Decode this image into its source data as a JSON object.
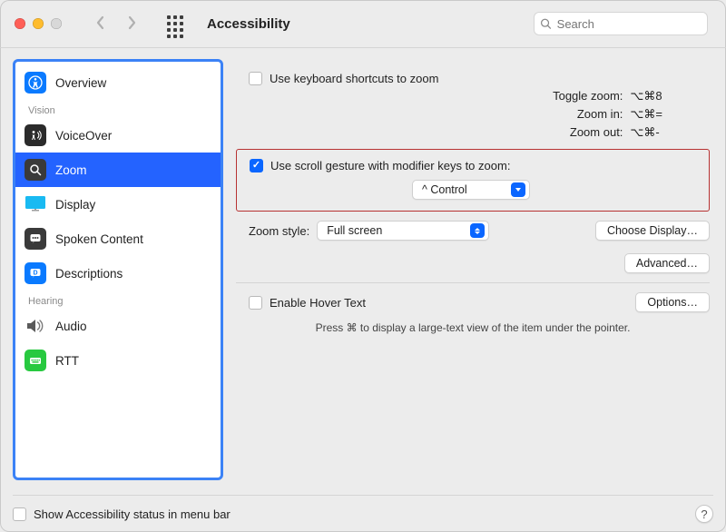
{
  "window": {
    "title": "Accessibility"
  },
  "search": {
    "placeholder": "Search"
  },
  "sidebar": {
    "groups": {
      "vision": "Vision",
      "hearing": "Hearing"
    },
    "items": [
      {
        "label": "Overview"
      },
      {
        "label": "VoiceOver"
      },
      {
        "label": "Zoom"
      },
      {
        "label": "Display"
      },
      {
        "label": "Spoken Content"
      },
      {
        "label": "Descriptions"
      },
      {
        "label": "Audio"
      },
      {
        "label": "RTT"
      }
    ]
  },
  "zoom": {
    "use_keyboard_shortcuts": "Use keyboard shortcuts to zoom",
    "shortcuts": {
      "toggle_label": "Toggle zoom:",
      "toggle_key": "⌥⌘8",
      "in_label": "Zoom in:",
      "in_key": "⌥⌘=",
      "out_label": "Zoom out:",
      "out_key": "⌥⌘-"
    },
    "scroll_gesture_label": "Use scroll gesture with modifier keys to zoom:",
    "modifier_select": "^ Control",
    "zoom_style_label": "Zoom style:",
    "zoom_style_value": "Full screen",
    "choose_display": "Choose Display…",
    "advanced": "Advanced…",
    "hover_text_label": "Enable Hover Text",
    "options": "Options…",
    "hover_hint": "Press ⌘ to display a large-text view of the item under the pointer."
  },
  "footer": {
    "status_label": "Show Accessibility status in menu bar",
    "help": "?"
  }
}
